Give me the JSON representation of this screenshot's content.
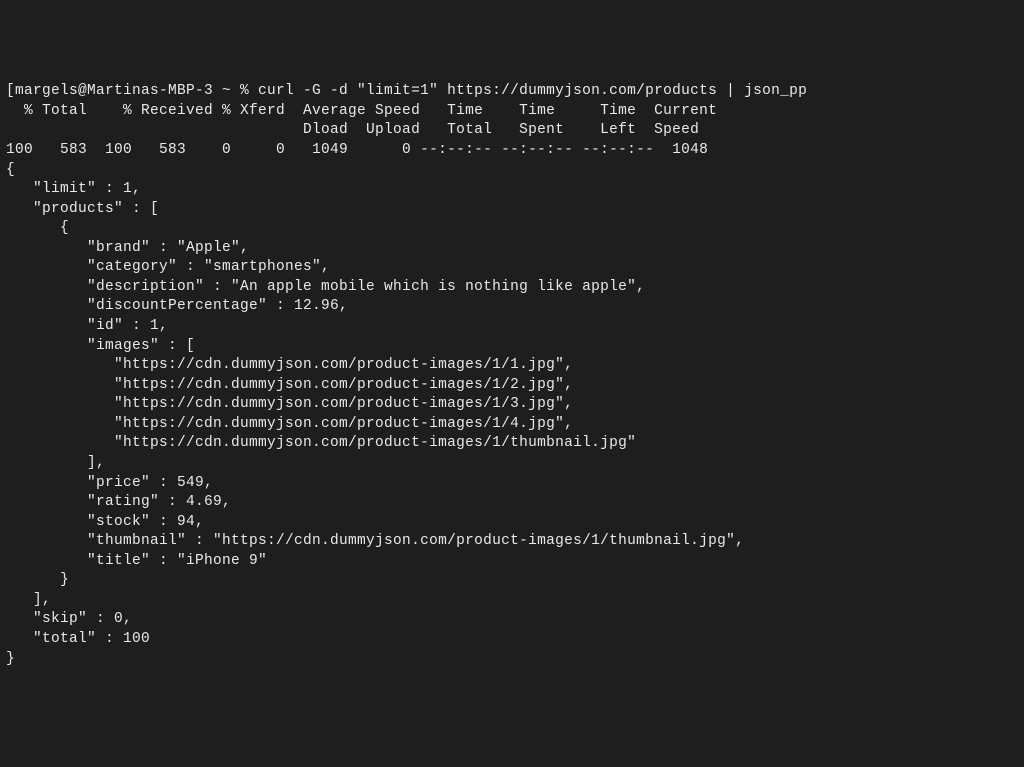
{
  "terminal": {
    "prompt_line": "[margels@Martinas-MBP-3 ~ % curl -G -d \"limit=1\" https://dummyjson.com/products | json_pp",
    "curl_header1": "  % Total    % Received % Xferd  Average Speed   Time    Time     Time  Current",
    "curl_header2": "                                 Dload  Upload   Total   Spent    Left  Speed",
    "curl_stats": "100   583  100   583    0     0   1049      0 --:--:-- --:--:-- --:--:--  1048",
    "json_open": "{",
    "json_limit": "   \"limit\" : 1,",
    "json_products_open": "   \"products\" : [",
    "json_obj_open": "      {",
    "json_brand": "         \"brand\" : \"Apple\",",
    "json_category": "         \"category\" : \"smartphones\",",
    "json_description": "         \"description\" : \"An apple mobile which is nothing like apple\",",
    "json_discount": "         \"discountPercentage\" : 12.96,",
    "json_id": "         \"id\" : 1,",
    "json_images_open": "         \"images\" : [",
    "json_img1": "            \"https://cdn.dummyjson.com/product-images/1/1.jpg\",",
    "json_img2": "            \"https://cdn.dummyjson.com/product-images/1/2.jpg\",",
    "json_img3": "            \"https://cdn.dummyjson.com/product-images/1/3.jpg\",",
    "json_img4": "            \"https://cdn.dummyjson.com/product-images/1/4.jpg\",",
    "json_img5": "            \"https://cdn.dummyjson.com/product-images/1/thumbnail.jpg\"",
    "json_images_close": "         ],",
    "json_price": "         \"price\" : 549,",
    "json_rating": "         \"rating\" : 4.69,",
    "json_stock": "         \"stock\" : 94,",
    "json_thumbnail": "         \"thumbnail\" : \"https://cdn.dummyjson.com/product-images/1/thumbnail.jpg\",",
    "json_title": "         \"title\" : \"iPhone 9\"",
    "json_obj_close": "      }",
    "json_products_close": "   ],",
    "json_skip": "   \"skip\" : 0,",
    "json_total": "   \"total\" : 100",
    "json_close": "}"
  }
}
